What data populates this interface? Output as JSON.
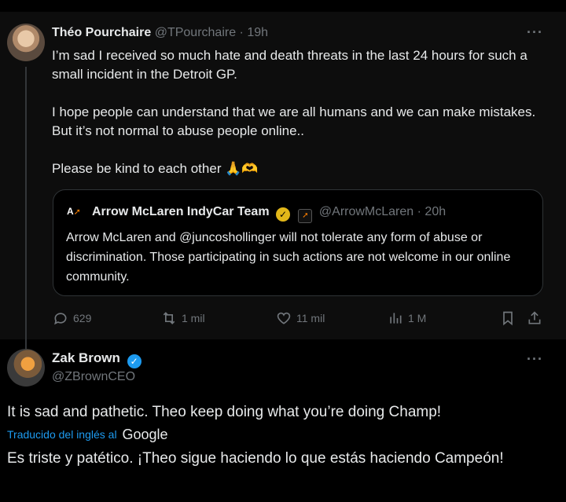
{
  "tweet1": {
    "author_name": "Théo Pourchaire",
    "author_handle": "@TPourchaire",
    "time": "· 19h",
    "paragraphs": [
      "I’m sad I received so much hate and death threats in the last 24 hours for such a small incident in the Detroit GP.",
      "I hope people can understand that we are all humans and we can make mistakes. But it’s not normal to abuse people online..",
      "Please be kind to each other 🙏🫶"
    ],
    "more_label": "···",
    "quote": {
      "logo_text": "A",
      "author_name": "Arrow McLaren IndyCar Team",
      "author_handle": "@ArrowMcLaren",
      "time": "· 20h",
      "text": "Arrow McLaren and @juncoshollinger will not tolerate any form of abuse or discrimination. Those participating in such actions are not welcome in our online community."
    },
    "actions": {
      "replies": "629",
      "reposts": "1 mil",
      "likes": "11 mil",
      "views": "1 M"
    }
  },
  "tweet2": {
    "author_name": "Zak Brown",
    "author_handle": "@ZBrownCEO",
    "more_label": "···",
    "text": "It is sad and pathetic.  Theo keep doing what you’re doing Champ!",
    "translated_label": "Traducido del inglés al",
    "translator": "Google",
    "translation": "Es triste y patético. ¡Theo sigue haciendo lo que estás haciendo Campeón!"
  },
  "colors": {
    "accent_blue": "#1d9bf0",
    "muted_gray": "#71767b",
    "gold_badge": "#e2b719"
  }
}
